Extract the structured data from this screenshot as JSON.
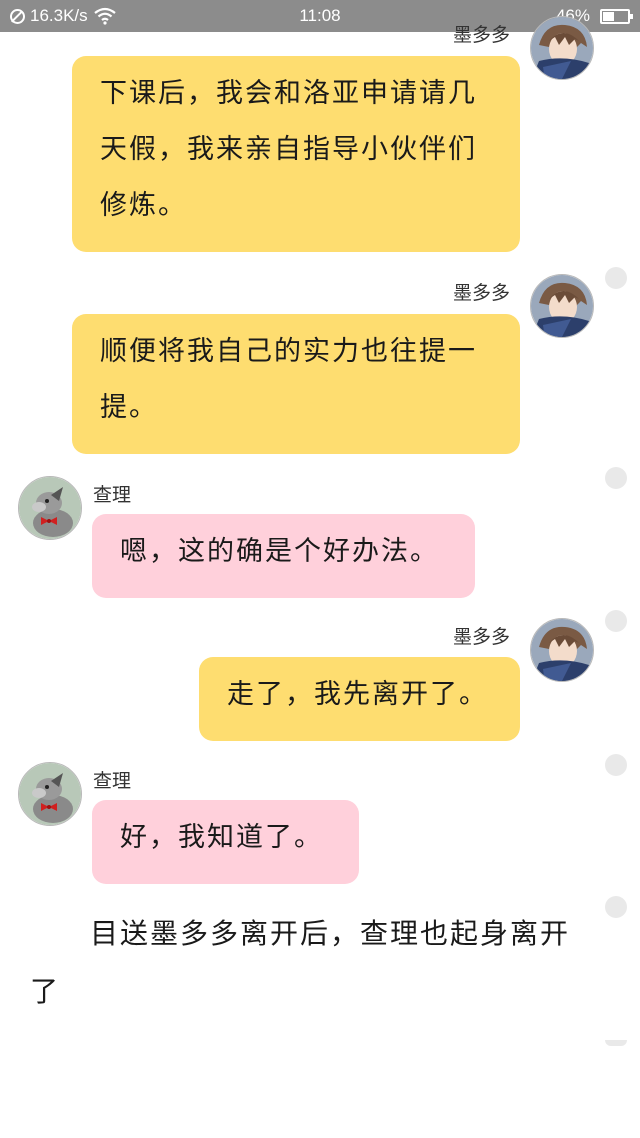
{
  "status_bar": {
    "network_speed": "16.3K/s",
    "time": "11:08",
    "battery": "46%",
    "battery_level": 0.46
  },
  "messages": [
    {
      "side": "right",
      "sender": "墨多多",
      "text": "下课后，我会和洛亚申请请几天假，我来亲自指导小伙伴们修炼。",
      "color": "#fedd70"
    },
    {
      "side": "right",
      "sender": "墨多多",
      "text": "顺便将我自己的实力也往提一提。",
      "color": "#fedd70"
    },
    {
      "side": "left",
      "sender": "查理",
      "text": "嗯，这的确是个好办法。",
      "color": "#ffd0db"
    },
    {
      "side": "right",
      "sender": "墨多多",
      "text": "走了，我先离开了。",
      "color": "#fedd70"
    },
    {
      "side": "left",
      "sender": "查理",
      "text": "好，我知道了。",
      "color": "#ffd0db"
    }
  ],
  "narration": "目送墨多多离开后，查理也起身离开了",
  "icons": {
    "modoodoo_avatar": "anime-boy-avatar",
    "charlie_avatar": "dog-avatar",
    "wifi": "wifi-icon",
    "battery": "battery-icon"
  }
}
